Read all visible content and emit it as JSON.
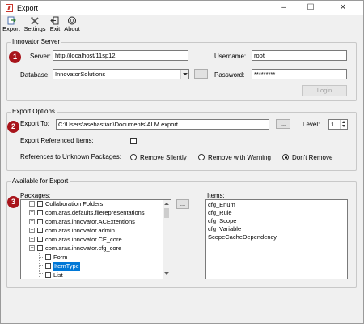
{
  "window": {
    "title": "Export",
    "controls": {
      "minimize": "–",
      "maximize": "☐",
      "close": "✕"
    }
  },
  "toolbar": {
    "buttons": [
      {
        "label": "Export",
        "icon": "export-icon"
      },
      {
        "label": "Settings",
        "icon": "settings-icon"
      },
      {
        "label": "Exit",
        "icon": "exit-icon"
      },
      {
        "label": "About",
        "icon": "about-icon"
      }
    ]
  },
  "badges": [
    "1",
    "2",
    "3"
  ],
  "server": {
    "group_title": "Innovator Server",
    "server_label": "Server:",
    "server_value": "http://localhost/11sp12",
    "username_label": "Username:",
    "username_value": "root",
    "database_label": "Database:",
    "database_value": "InnovatorSolutions",
    "browse_label": "...",
    "password_label": "Password:",
    "password_value": "*********",
    "login_label": "Login"
  },
  "options": {
    "group_title": "Export Options",
    "export_to_label": "Export To:",
    "export_to_value": "C:\\Users\\asebastian\\Documents\\ALM export",
    "browse_label": "...",
    "level_label": "Level:",
    "level_value": "1",
    "export_referenced_label": "Export Referenced Items:",
    "export_referenced_checked": false,
    "unknown_packages_label": "References to Unknown Packages:",
    "radios": [
      {
        "label": "Remove Silently",
        "checked": false
      },
      {
        "label": "Remove with Warning",
        "checked": false
      },
      {
        "label": "Don't Remove",
        "checked": true
      }
    ]
  },
  "available": {
    "group_title": "Available for Export",
    "packages_label": "Packages:",
    "items_label": "Items:",
    "move_button_label": "...",
    "packages": [
      {
        "label": "Collaboration Folders",
        "expander": "+",
        "level": 0
      },
      {
        "label": "com.aras.defaults.filerepresentations",
        "expander": "+",
        "level": 0
      },
      {
        "label": "com.aras.innovator.ACExtentions",
        "expander": "+",
        "level": 0
      },
      {
        "label": "com.aras.innovator.admin",
        "expander": "+",
        "level": 0
      },
      {
        "label": "com.aras.innovator.CE_core",
        "expander": "+",
        "level": 0
      },
      {
        "label": "com.aras.innovator.cfg_core",
        "expander": "−",
        "level": 0
      },
      {
        "label": "Form",
        "expander": "",
        "level": 1
      },
      {
        "label": "ItemType",
        "expander": "",
        "level": 1,
        "selected": true
      },
      {
        "label": "List",
        "expander": "",
        "level": 1
      }
    ],
    "items": [
      "cfg_Enum",
      "cfg_Rule",
      "cfg_Scope",
      "cfg_Variable",
      "ScopeCacheDependency"
    ]
  }
}
